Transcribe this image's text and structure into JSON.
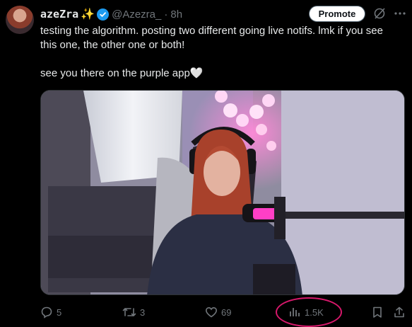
{
  "tweet": {
    "display_name": "azeZra",
    "sparkle_emoji": "✨",
    "handle": "@Azezra_",
    "separator": "·",
    "timestamp": "8h",
    "promote_label": "Promote",
    "text_line_1": "testing the algorithm. posting two different going live notifs. lmk if you see this one, the other one or both!",
    "text_line_2": "see you there on the purple app🤍"
  },
  "media": {
    "description": "streamer with headset, pink mic and LED lights"
  },
  "actions": {
    "replies": "5",
    "retweets": "3",
    "likes": "69",
    "views": "1.5K"
  },
  "colors": {
    "verified": "#1d9bf0",
    "annotation_circle": "#d7186b",
    "muted": "#71767b"
  }
}
